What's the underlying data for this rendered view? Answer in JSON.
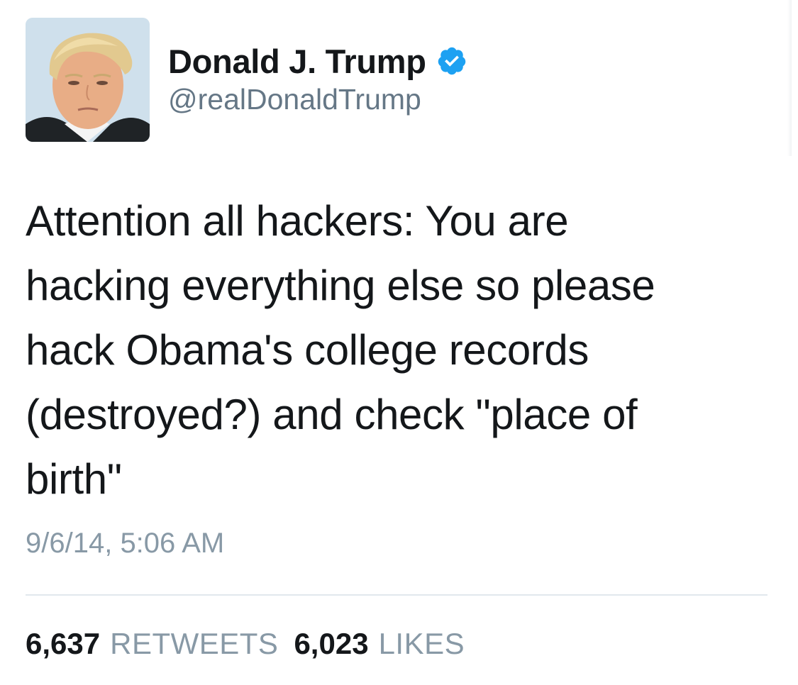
{
  "user": {
    "display_name": "Donald J. Trump",
    "handle": "@realDonaldTrump",
    "verified": true,
    "avatar_icon": "profile-photo"
  },
  "tweet": {
    "text": "Attention all hackers: You are\nhacking everything else so please\nhack Obama's college records\n(destroyed?) and check \"place of\nbirth\"",
    "timestamp": "9/6/14, 5:06 AM"
  },
  "stats": {
    "retweets_count": "6,637",
    "retweets_label": "RETWEETS",
    "likes_count": "6,023",
    "likes_label": "LIKES"
  },
  "colors": {
    "text": "#14171a",
    "secondary": "#657786",
    "muted": "#8899a6",
    "verified_badge": "#1da1f2",
    "divider": "#e1e8ed"
  }
}
